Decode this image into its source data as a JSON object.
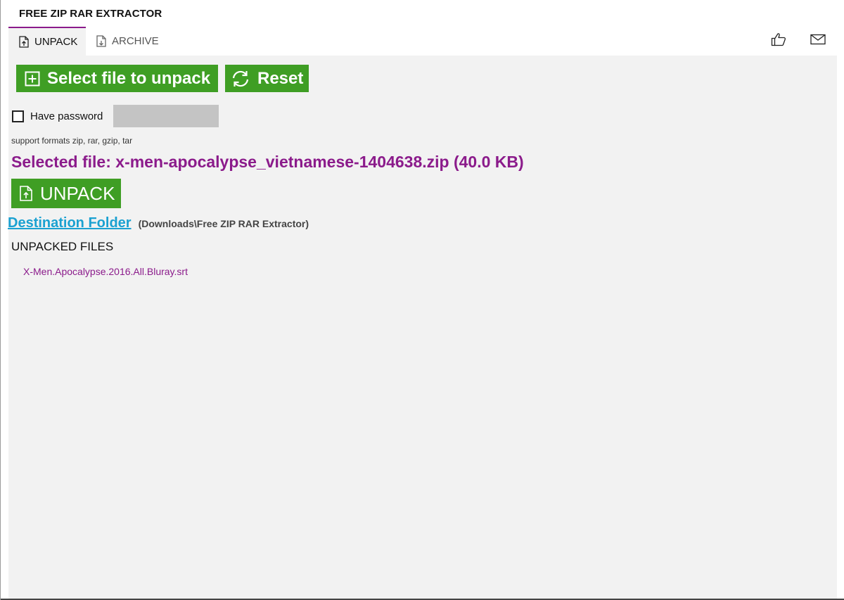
{
  "app": {
    "title": "FREE ZIP RAR EXTRACTOR"
  },
  "tabs": [
    {
      "label": "UNPACK",
      "icon": "document-upload-icon",
      "active": true
    },
    {
      "label": "ARCHIVE",
      "icon": "document-archive-icon",
      "active": false
    }
  ],
  "header_icons": [
    "thumbs-up-icon",
    "mail-icon"
  ],
  "actions": {
    "select_label": "Select file to unpack",
    "reset_label": "Reset",
    "unpack_label": "UNPACK"
  },
  "password": {
    "label": "Have password",
    "checked": false,
    "value": ""
  },
  "support_text": "support formats zip, rar, gzip, tar",
  "selected_file_text": "Selected file: x-men-apocalypse_vietnamese-1404638.zip (40.0 KB)",
  "destination": {
    "link_label": "Destination Folder",
    "path": "(Downloads\\Free ZIP RAR Extractor)"
  },
  "unpacked": {
    "header": "UNPACKED FILES",
    "files": [
      "X-Men.Apocalypse.2016.All.Bluray.srt"
    ]
  },
  "colors": {
    "accent_green": "#3f9e24",
    "accent_purple": "#8b1b8b",
    "link_blue": "#1aa1d1",
    "panel_bg": "#f2f2f2"
  }
}
